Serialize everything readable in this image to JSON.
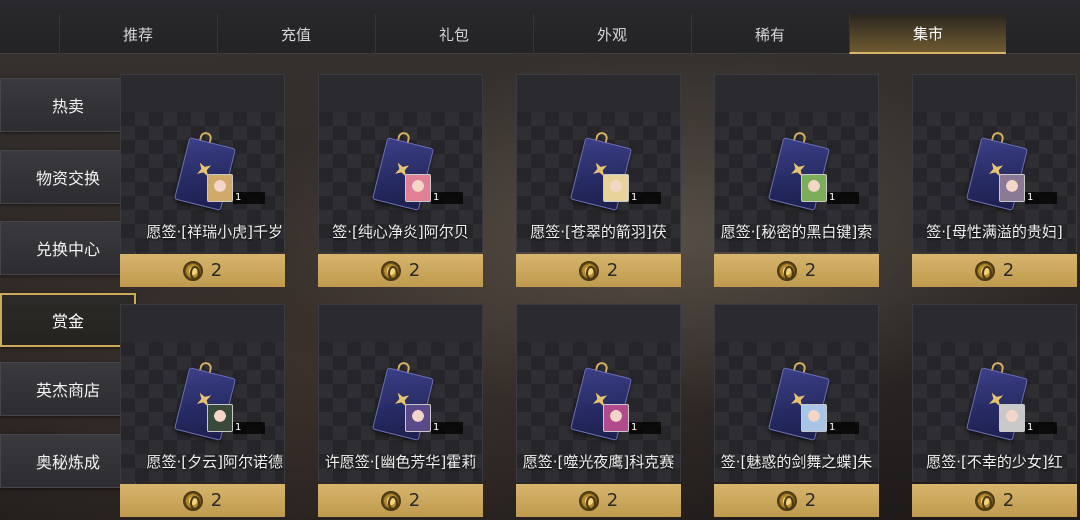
{
  "tabs": [
    {
      "label": "推荐"
    },
    {
      "label": "充值"
    },
    {
      "label": "礼包"
    },
    {
      "label": "外观"
    },
    {
      "label": "稀有"
    },
    {
      "label": "集市",
      "active": true
    }
  ],
  "sidebar": {
    "items": [
      {
        "label": "热卖"
      },
      {
        "label": "物资交换"
      },
      {
        "label": "兑换中心"
      },
      {
        "label": "赏金",
        "active": true
      },
      {
        "label": "英杰商店"
      },
      {
        "label": "奥秘炼成"
      }
    ]
  },
  "items": [
    {
      "name": "愿签·[祥瑞小虎]千岁",
      "qty": "1",
      "price": "2",
      "hair": "#d1a968"
    },
    {
      "name": "签·[纯心净炎]阿尔贝",
      "qty": "1",
      "price": "2",
      "hair": "#e07f96"
    },
    {
      "name": "愿签·[苍翠的箭羽]茯",
      "qty": "1",
      "price": "2",
      "hair": "#e8d49a"
    },
    {
      "name": "愿签·[秘密的黑白键]索",
      "qty": "1",
      "price": "2",
      "hair": "#7cae5a"
    },
    {
      "name": "签·[母性满溢的贵妇]",
      "qty": "1",
      "price": "2",
      "hair": "#8a7a96"
    },
    {
      "name": "愿签·[夕云]阿尔诺德",
      "qty": "1",
      "price": "2",
      "hair": "#3a4a3a"
    },
    {
      "name": "许愿签·[幽色芳华]霍莉",
      "qty": "1",
      "price": "2",
      "hair": "#5a4a8a"
    },
    {
      "name": "愿签·[噬光夜鹰]科克赛",
      "qty": "1",
      "price": "2",
      "hair": "#b24a8e"
    },
    {
      "name": "签·[魅惑的剑舞之蝶]朱",
      "qty": "1",
      "price": "2",
      "hair": "#a8c4e6"
    },
    {
      "name": "愿签·[不幸的少女]红",
      "qty": "1",
      "price": "2",
      "hair": "#c9c9c9"
    }
  ],
  "colors": {
    "accent_gold": "#d7b56c",
    "active_border": "#cfa95a"
  }
}
